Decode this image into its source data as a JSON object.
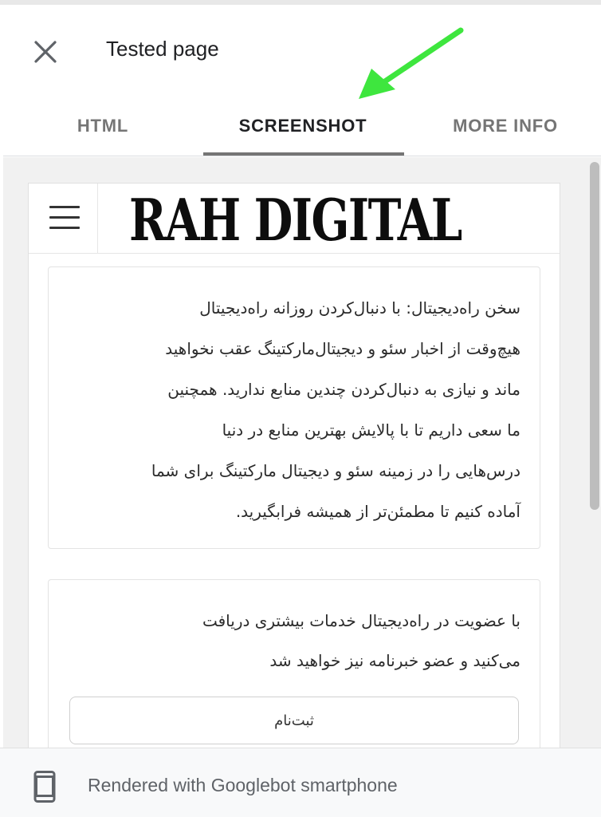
{
  "dialog": {
    "title": "Tested page",
    "close_icon": "close-icon"
  },
  "tabs": [
    {
      "label": "HTML",
      "active": false
    },
    {
      "label": "SCREENSHOT",
      "active": true
    },
    {
      "label": "MORE INFO",
      "active": false
    }
  ],
  "annotation": {
    "arrow_color": "#3ee63e",
    "points_to": "SCREENSHOT"
  },
  "site": {
    "logo": "RAH DIGITAL",
    "menu_icon": "hamburger-menu-icon",
    "intro_lines": [
      "سخن راه‌دیجیتال: با دنبال‌کردن روزانه راه‌دیجیتال",
      "هیچ‌وقت از اخبار سئو و دیجیتال‌مارکتینگ عقب نخواهید",
      "ماند و نیازی به دنبال‌کردن چندین منابع ندارید. همچنین",
      "ما سعی داریم تا با پالایش بهترین منابع در دنیا",
      "درس‌هایی را در زمینه سئو و دیجیتال مارکتینگ برای شما",
      "آماده کنیم تا مطمئن‌تر از همیشه فرابگیرید."
    ],
    "membership_lines": [
      "با عضویت در راه‌دیجیتال خدمات بیشتری دریافت",
      "می‌کنید و عضو خبرنامه نیز خواهید شد"
    ],
    "signup_label": "ثبت‌نام"
  },
  "footer": {
    "device_icon": "smartphone-icon",
    "text": "Rendered with Googlebot smartphone"
  },
  "colors": {
    "accent_arrow": "#3ee63e",
    "tab_active": "#202124",
    "tab_inactive": "#757575"
  }
}
